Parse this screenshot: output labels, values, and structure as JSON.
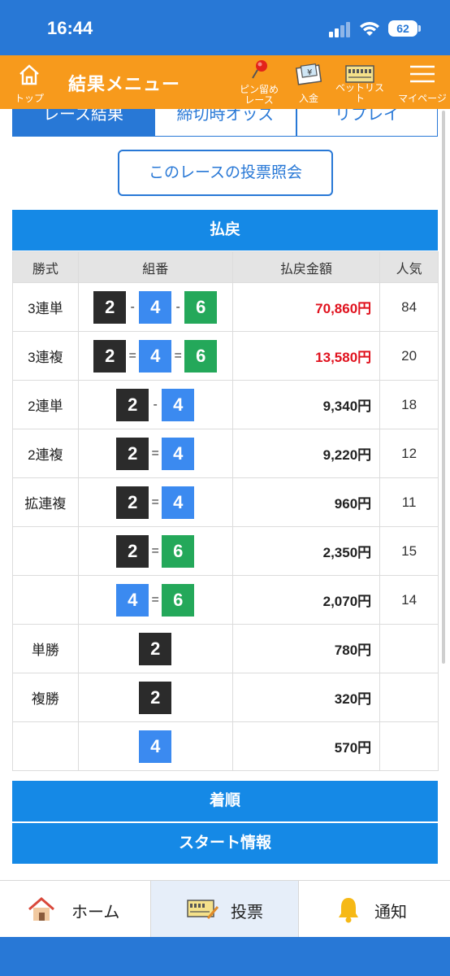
{
  "status_bar": {
    "time": "16:44",
    "battery": "62"
  },
  "header": {
    "home_label": "トップ",
    "title": "結果メニュー",
    "pin_label_1": "ピン留め",
    "pin_label_2": "レース",
    "deposit_label": "入金",
    "betlist_label": "ベットリスト",
    "mypage_label": "マイページ"
  },
  "tabs": [
    "レース結果",
    "締切時オッズ",
    "リプレイ"
  ],
  "inquiry_button": "このレースの投票照会",
  "payout": {
    "title": "払戻",
    "headers": [
      "勝式",
      "組番",
      "払戻金額",
      "人気"
    ],
    "rows": [
      {
        "type": "3連単",
        "combo": [
          "2",
          "-",
          "4",
          "-",
          "6"
        ],
        "amount": "70,860円",
        "pop": "84",
        "highlight": true
      },
      {
        "type": "3連複",
        "combo": [
          "2",
          "=",
          "4",
          "=",
          "6"
        ],
        "amount": "13,580円",
        "pop": "20",
        "highlight": true
      },
      {
        "type": "2連単",
        "combo": [
          "2",
          "-",
          "4"
        ],
        "amount": "9,340円",
        "pop": "18",
        "highlight": false
      },
      {
        "type": "2連複",
        "combo": [
          "2",
          "=",
          "4"
        ],
        "amount": "9,220円",
        "pop": "12",
        "highlight": false
      },
      {
        "type": "拡連複",
        "combo": [
          "2",
          "=",
          "4"
        ],
        "amount": "960円",
        "pop": "11",
        "highlight": false
      },
      {
        "type": "",
        "combo": [
          "2",
          "=",
          "6"
        ],
        "amount": "2,350円",
        "pop": "15",
        "highlight": false
      },
      {
        "type": "",
        "combo": [
          "4",
          "=",
          "6"
        ],
        "amount": "2,070円",
        "pop": "14",
        "highlight": false
      },
      {
        "type": "単勝",
        "combo": [
          "2"
        ],
        "amount": "780円",
        "pop": "",
        "highlight": false
      },
      {
        "type": "複勝",
        "combo": [
          "2"
        ],
        "amount": "320円",
        "pop": "",
        "highlight": false
      },
      {
        "type": "",
        "combo": [
          "4"
        ],
        "amount": "570円",
        "pop": "",
        "highlight": false
      }
    ]
  },
  "sections": [
    "着順",
    "スタート情報"
  ],
  "bottom_nav": {
    "home": "ホーム",
    "vote": "投票",
    "notify": "通知"
  },
  "colors": {
    "brand_blue": "#2878d6",
    "header_orange": "#f79a1c",
    "section_blue": "#1589e6",
    "boat_2": "#2b2b2b",
    "boat_4": "#3b8af0",
    "boat_6": "#24a85a",
    "highlight_red": "#e0121e"
  },
  "icons": [
    "signal-icon",
    "wifi-icon",
    "home-icon",
    "pin-icon",
    "deposit-icon",
    "ticket-icon",
    "menu-icon",
    "house-icon",
    "bell-icon"
  ]
}
